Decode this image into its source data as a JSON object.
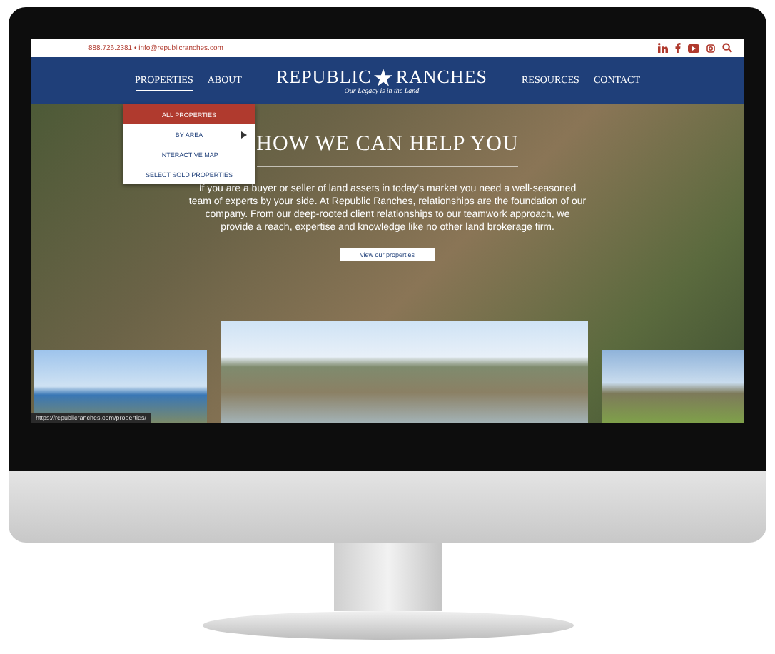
{
  "top_bar": {
    "contact": "888.726.2381 • info@republicranches.com"
  },
  "nav": {
    "left": [
      {
        "label": "PROPERTIES",
        "selected": true
      },
      {
        "label": "ABOUT",
        "selected": false
      }
    ],
    "logo": {
      "left": "REPUBLIC",
      "right": "RANCHES",
      "tagline": "Our Legacy is in the Land"
    },
    "right": [
      {
        "label": "RESOURCES",
        "selected": false
      },
      {
        "label": "CONTACT",
        "selected": false
      }
    ]
  },
  "dropdown": [
    {
      "label": "ALL PROPERTIES",
      "selected": true,
      "has_submenu": false
    },
    {
      "label": "BY AREA",
      "selected": false,
      "has_submenu": true
    },
    {
      "label": "INTERACTIVE MAP",
      "selected": false,
      "has_submenu": false
    },
    {
      "label": "SELECT SOLD PROPERTIES",
      "selected": false,
      "has_submenu": false
    }
  ],
  "hero": {
    "heading": "HOW WE CAN HELP YOU",
    "text": "If you are a buyer or seller of land assets in today's market you need a well-seasoned team of experts by your side. At Republic Ranches, relationships are the foundation of our company. From our deep-rooted client relationships to our teamwork approach, we provide a reach, expertise and knowledge like no other land brokerage firm.",
    "button": "view our properties"
  },
  "status_url": "https://republicranches.com/properties/"
}
